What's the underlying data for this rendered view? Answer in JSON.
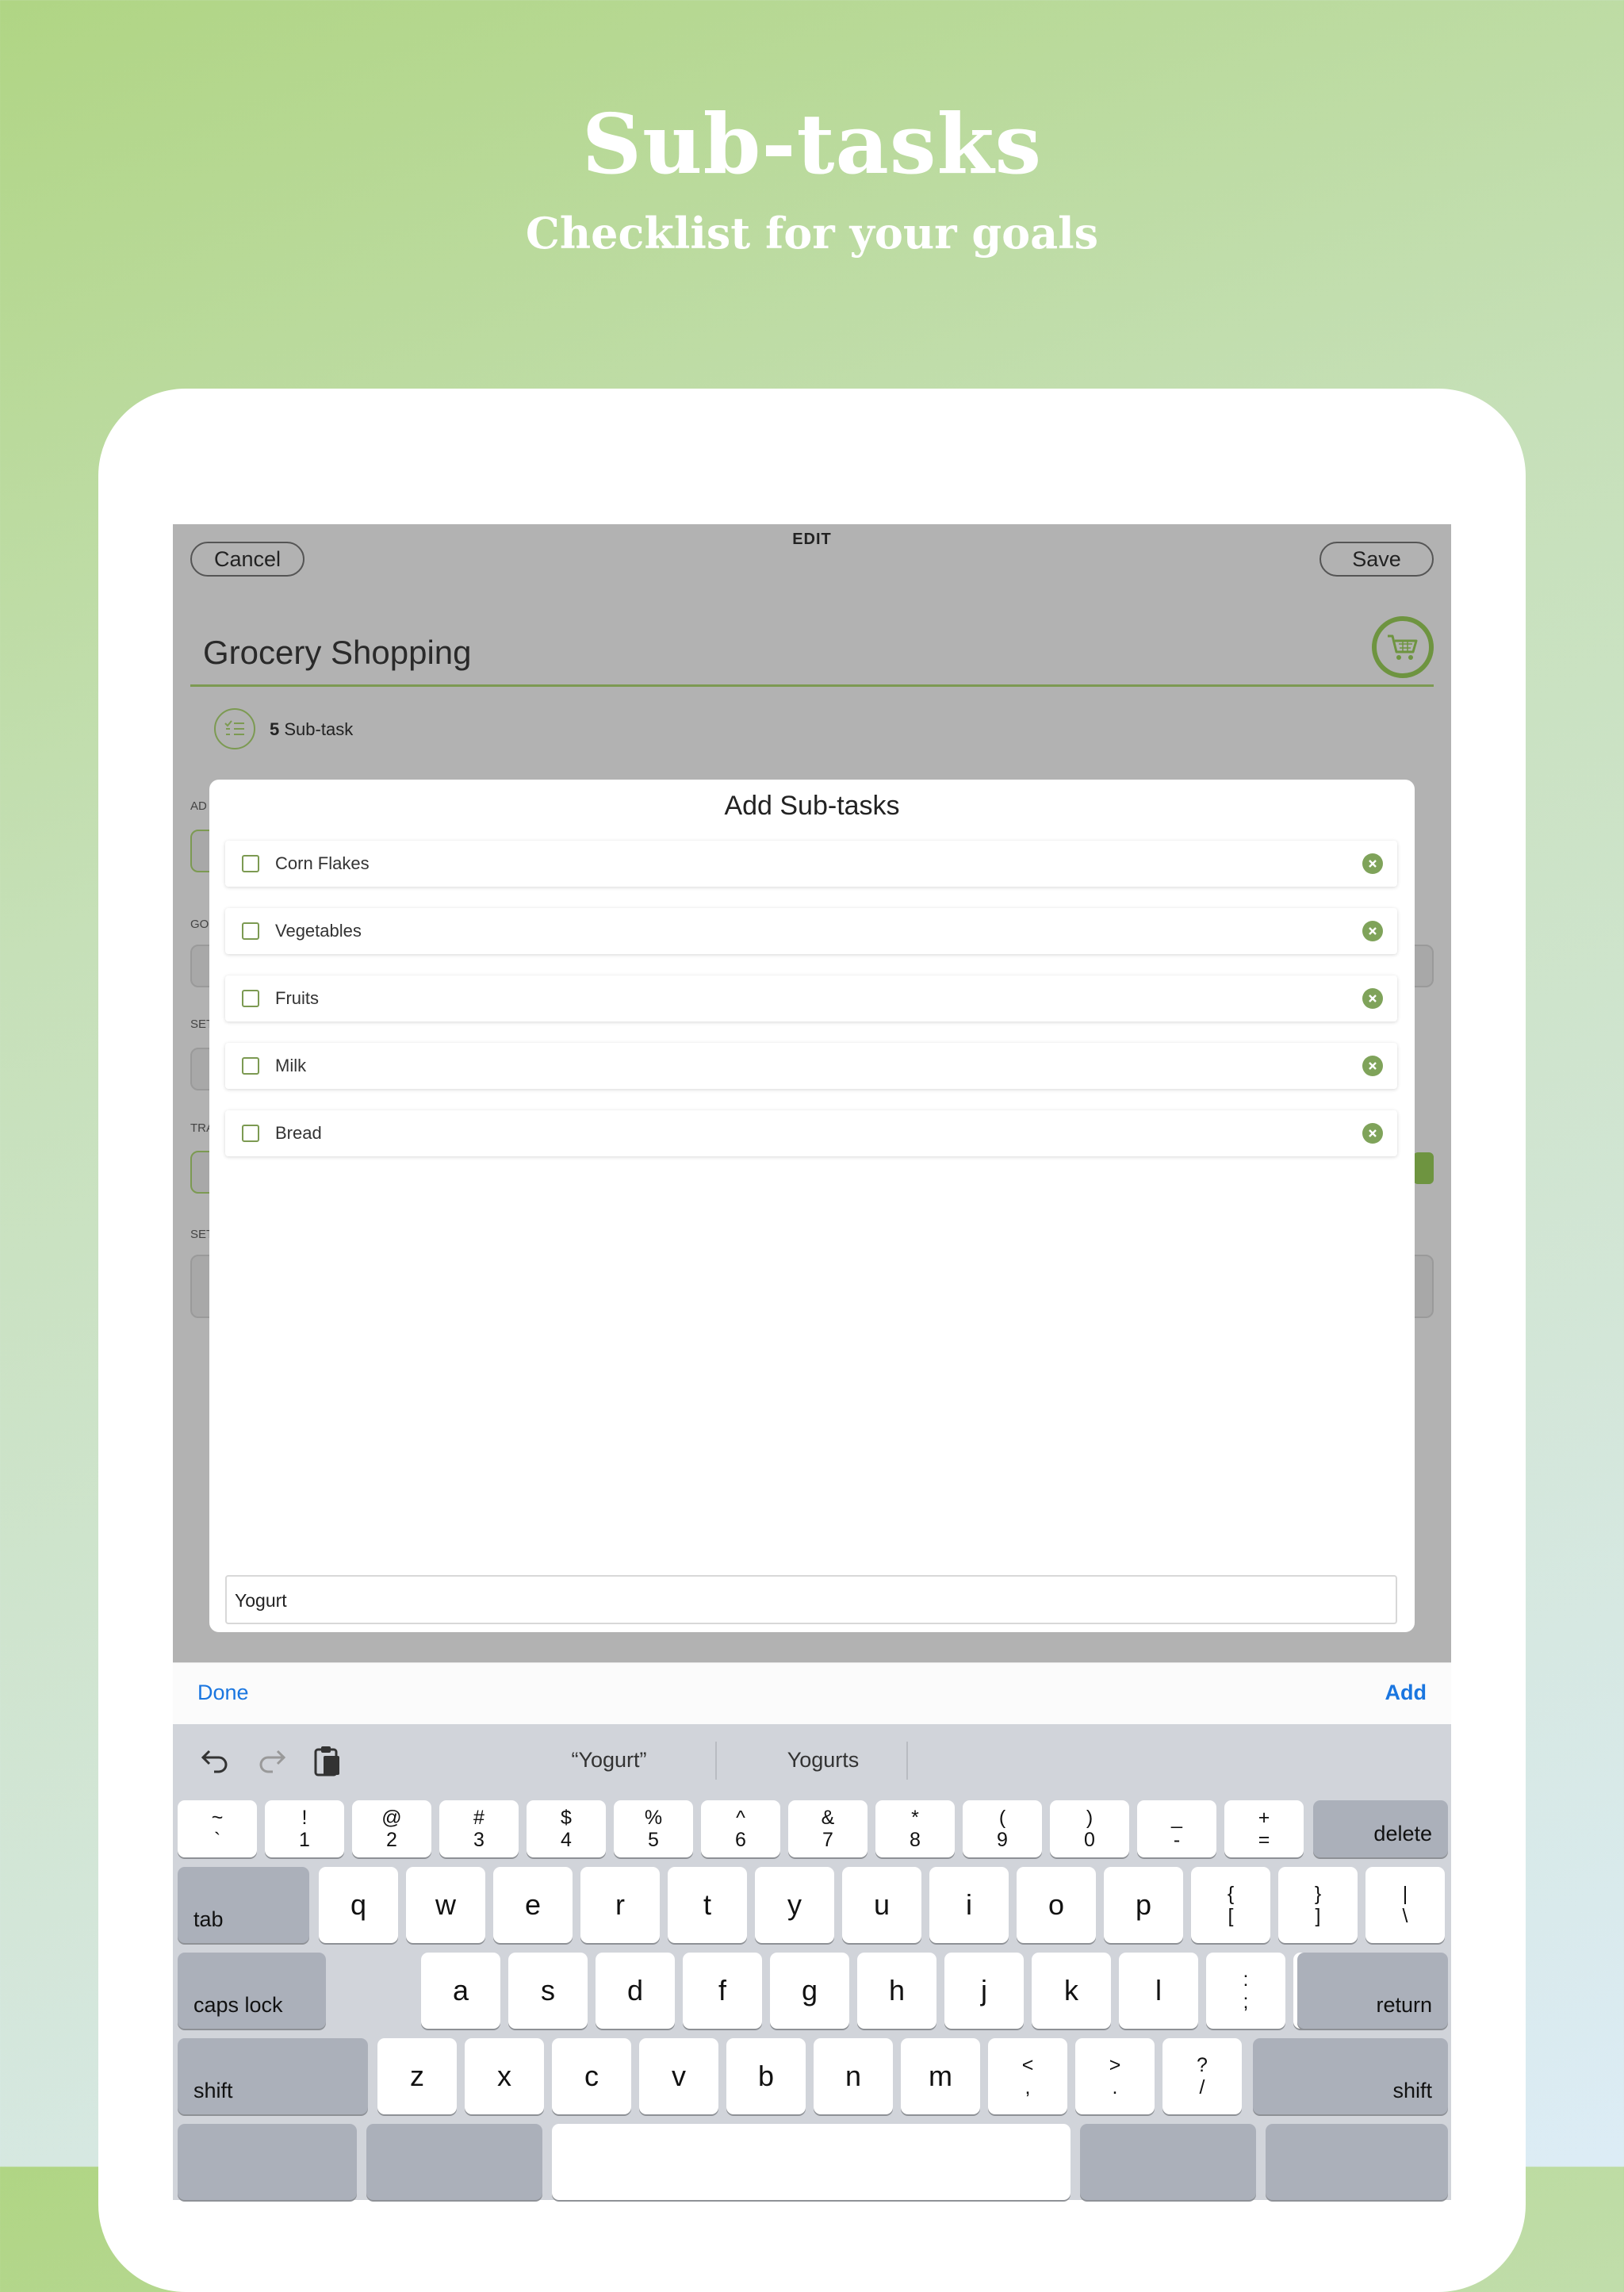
{
  "hero": {
    "title": "Sub-tasks",
    "subtitle": "Checklist for your goals"
  },
  "edit_screen": {
    "title": "EDIT",
    "cancel_label": "Cancel",
    "save_label": "Save",
    "goal_name": "Grocery Shopping",
    "subtask_count": "5",
    "subtask_label": "Sub-task",
    "side_labels": [
      "AD",
      "GO",
      "SET",
      "TRA",
      "SET"
    ]
  },
  "modal": {
    "title": "Add Sub-tasks",
    "items": [
      {
        "label": "Corn Flakes"
      },
      {
        "label": "Vegetables"
      },
      {
        "label": "Fruits"
      },
      {
        "label": "Milk"
      },
      {
        "label": "Bread"
      }
    ],
    "input_value": "Yogurt"
  },
  "accessory": {
    "done_label": "Done",
    "add_label": "Add"
  },
  "keyboard": {
    "suggestions": [
      "“Yogurt”",
      "Yogurts"
    ],
    "number_row": [
      [
        "~",
        "`"
      ],
      [
        "!",
        "1"
      ],
      [
        "@",
        "2"
      ],
      [
        "#",
        "3"
      ],
      [
        "$",
        "4"
      ],
      [
        "%",
        "5"
      ],
      [
        "^",
        "6"
      ],
      [
        "&",
        "7"
      ],
      [
        "*",
        "8"
      ],
      [
        "(",
        "9"
      ],
      [
        ")",
        "0"
      ],
      [
        "_",
        "-"
      ],
      [
        "+",
        "="
      ]
    ],
    "delete_label": "delete",
    "tab_label": "tab",
    "row1": [
      "q",
      "w",
      "e",
      "r",
      "t",
      "y",
      "u",
      "i",
      "o",
      "p"
    ],
    "row1_extra": [
      [
        "{",
        "["
      ],
      [
        "}",
        "]"
      ],
      [
        "|",
        "\\"
      ]
    ],
    "caps_label": "caps lock",
    "row2": [
      "a",
      "s",
      "d",
      "f",
      "g",
      "h",
      "j",
      "k",
      "l"
    ],
    "row2_extra": [
      [
        ":",
        ";"
      ],
      [
        "”",
        ","
      ]
    ],
    "return_label": "return",
    "shift_label": "shift",
    "row3": [
      "z",
      "x",
      "c",
      "v",
      "b",
      "n",
      "m"
    ],
    "row3_extra": [
      [
        "<",
        ","
      ],
      [
        ">",
        "."
      ],
      [
        "?",
        "/"
      ]
    ]
  },
  "colors": {
    "accent_green": "#7c9a52",
    "link_blue": "#1a76e0"
  }
}
